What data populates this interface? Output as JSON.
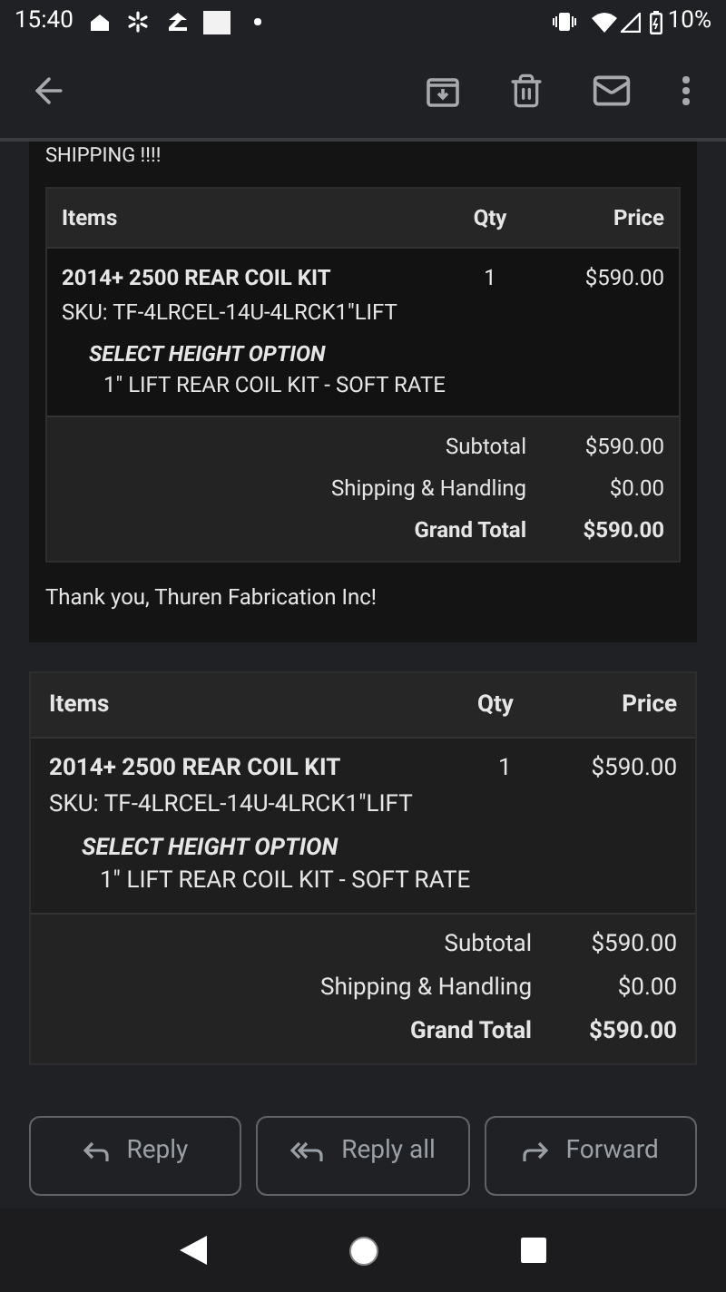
{
  "status_bar": {
    "time": "15:40",
    "battery": "10%"
  },
  "message": {
    "intro_tail": "SHIPPING !!!!",
    "order": {
      "columns": [
        "Items",
        "Qty",
        "Price"
      ],
      "item": {
        "name": "2014+ 2500 REAR COIL KIT",
        "sku": "SKU: TF-4LRCEL-14U-4LRCK1\"LIFT",
        "option_label": "SELECT HEIGHT OPTION",
        "option_value": "1\" LIFT REAR COIL KIT - SOFT RATE",
        "qty": "1",
        "price": "$590.00"
      },
      "totals": [
        {
          "label": "Subtotal",
          "value": "$590.00",
          "bold": false
        },
        {
          "label": "Shipping & Handling",
          "value": "$0.00",
          "bold": false
        },
        {
          "label": "Grand Total",
          "value": "$590.00",
          "bold": true
        }
      ]
    },
    "thanks": "Thank you, Thuren Fabrication Inc!"
  },
  "order": {
    "columns": [
      "Items",
      "Qty",
      "Price"
    ],
    "item": {
      "name": "2014+ 2500 REAR COIL KIT",
      "sku": "SKU: TF-4LRCEL-14U-4LRCK1\"LIFT",
      "option_label": "SELECT HEIGHT OPTION",
      "option_value": "1\" LIFT REAR COIL KIT - SOFT RATE",
      "qty": "1",
      "price": "$590.00"
    },
    "totals": [
      {
        "label": "Subtotal",
        "value": "$590.00",
        "bold": false
      },
      {
        "label": "Shipping & Handling",
        "value": "$0.00",
        "bold": false
      },
      {
        "label": "Grand Total",
        "value": "$590.00",
        "bold": true
      }
    ]
  },
  "actions": [
    {
      "kind": "reply",
      "label": "Reply"
    },
    {
      "kind": "reply_all",
      "label": "Reply all"
    },
    {
      "kind": "forward",
      "label": "Forward"
    }
  ]
}
